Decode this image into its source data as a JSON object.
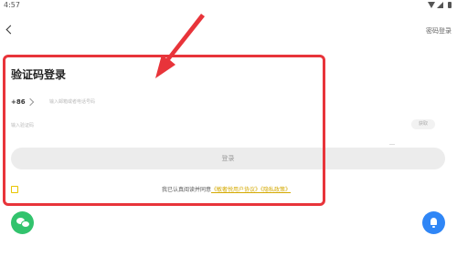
{
  "status_bar": {
    "time": "4:57",
    "icons": [
      "wifi-icon",
      "signal-icon",
      "battery-icon"
    ]
  },
  "top_bar": {
    "back_icon": "chevron-left-icon",
    "password_login_label": "密码登录"
  },
  "form": {
    "title": "验证码登录",
    "country_code": "+86",
    "phone_placeholder": "输入邮箱或者电话号码",
    "code_placeholder": "输入验证码",
    "get_code_label": "获取",
    "login_label": "登录"
  },
  "agreement": {
    "prefix": "我已认真阅读并同意",
    "user_agreement": "《敏奢悦用户协议》",
    "privacy_policy": "《隐私政策》"
  },
  "bottom": {
    "wechat_icon": "wechat-icon",
    "notification_icon": "bell-icon"
  },
  "colors": {
    "annotation_red": "#e8343a",
    "wechat_green": "#32c36d",
    "accent_blue": "#2f86f6",
    "link_gold": "#d4a900"
  }
}
